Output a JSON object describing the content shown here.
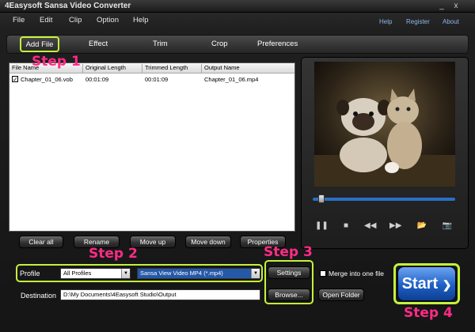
{
  "window": {
    "title": "4Easysoft Sansa Video Converter",
    "minimize": "_",
    "close": "x"
  },
  "menu": {
    "items": [
      "File",
      "Edit",
      "Clip",
      "Option",
      "Help"
    ],
    "right": [
      "Help",
      "Register",
      "About"
    ]
  },
  "toolbar": {
    "items": [
      "Add File",
      "Effect",
      "Trim",
      "Crop",
      "Preferences"
    ]
  },
  "filelist": {
    "columns": [
      "File Name",
      "Original Length",
      "Trimmed Length",
      "Output Name"
    ],
    "rows": [
      {
        "checked": true,
        "file_name": "Chapter_01_06.vob",
        "original_length": "00:01:09",
        "trimmed_length": "00:01:09",
        "output_name": "Chapter_01_06.mp4"
      }
    ]
  },
  "list_buttons": {
    "clear_all": "Clear all",
    "rename": "Rename",
    "move_up": "Move up",
    "move_down": "Move down",
    "properties": "Properties"
  },
  "preview": {
    "progress": 0.04
  },
  "settings": {
    "profile_label": "Profile",
    "profile_category": "All Profiles",
    "profile_value": "Sansa View Video MP4 (*.mp4)",
    "settings_button": "Settings",
    "merge_label": "Merge into one file",
    "merge_checked": false,
    "destination_label": "Destination",
    "destination_value": "D:\\My Documents\\4Easysoft Studio\\Output",
    "browse_button": "Browse...",
    "open_folder_button": "Open Folder"
  },
  "start": {
    "label": "Start"
  },
  "annotations": {
    "step1": "Step 1",
    "step2": "Step 2",
    "step3": "Step 3",
    "step4": "Step 4"
  },
  "colors": {
    "highlight": "#c5f23c",
    "step_text": "#ff2b86",
    "accent_blue": "#2b6fc6"
  }
}
